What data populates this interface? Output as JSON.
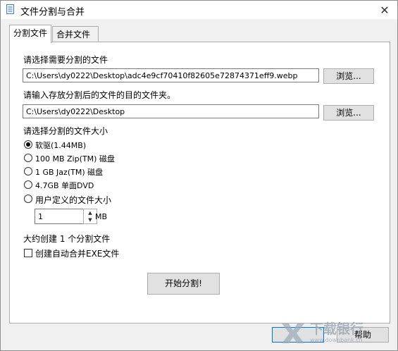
{
  "window": {
    "title": "文件分割与合并",
    "close_glyph": "✕"
  },
  "tabs": [
    {
      "label": "分割文件",
      "active": true
    },
    {
      "label": "合并文件",
      "active": false
    }
  ],
  "split": {
    "source_label": "请选择需要分割的文件",
    "source_value": "C:\\Users\\dy0222\\Desktop\\adc4e9cf70410f82605e72874371eff9.webp",
    "browse_label_1": "浏览...",
    "dest_label": "请输入存放分割后的文件的目的文件夹。",
    "dest_value": "C:\\Users\\dy0222\\Desktop",
    "browse_label_2": "浏览...",
    "size_label": "请选择分割的文件大小",
    "size_options": [
      {
        "label": "软驱(1.44MB)",
        "selected": true
      },
      {
        "label": "100 MB Zip(TM) 磁盘",
        "selected": false
      },
      {
        "label": "1 GB Jaz(TM) 磁盘",
        "selected": false
      },
      {
        "label": "4.7GB 单面DVD",
        "selected": false
      },
      {
        "label": "用户定义的文件大小",
        "selected": false
      }
    ],
    "custom_size_value": "1",
    "custom_size_unit": "MB",
    "estimate_text": "大约创建 1 个分割文件",
    "auto_merge_label": "创建自动合并EXE文件",
    "auto_merge_checked": false,
    "start_button": "开始分割!"
  },
  "footer": {
    "help_button": "帮助"
  },
  "watermark": {
    "text": "下载银行",
    "url": "www.downbank.cn"
  },
  "colors": {
    "accent": "#0078d7",
    "panel": "#ffffff",
    "window": "#f0f0f0"
  }
}
